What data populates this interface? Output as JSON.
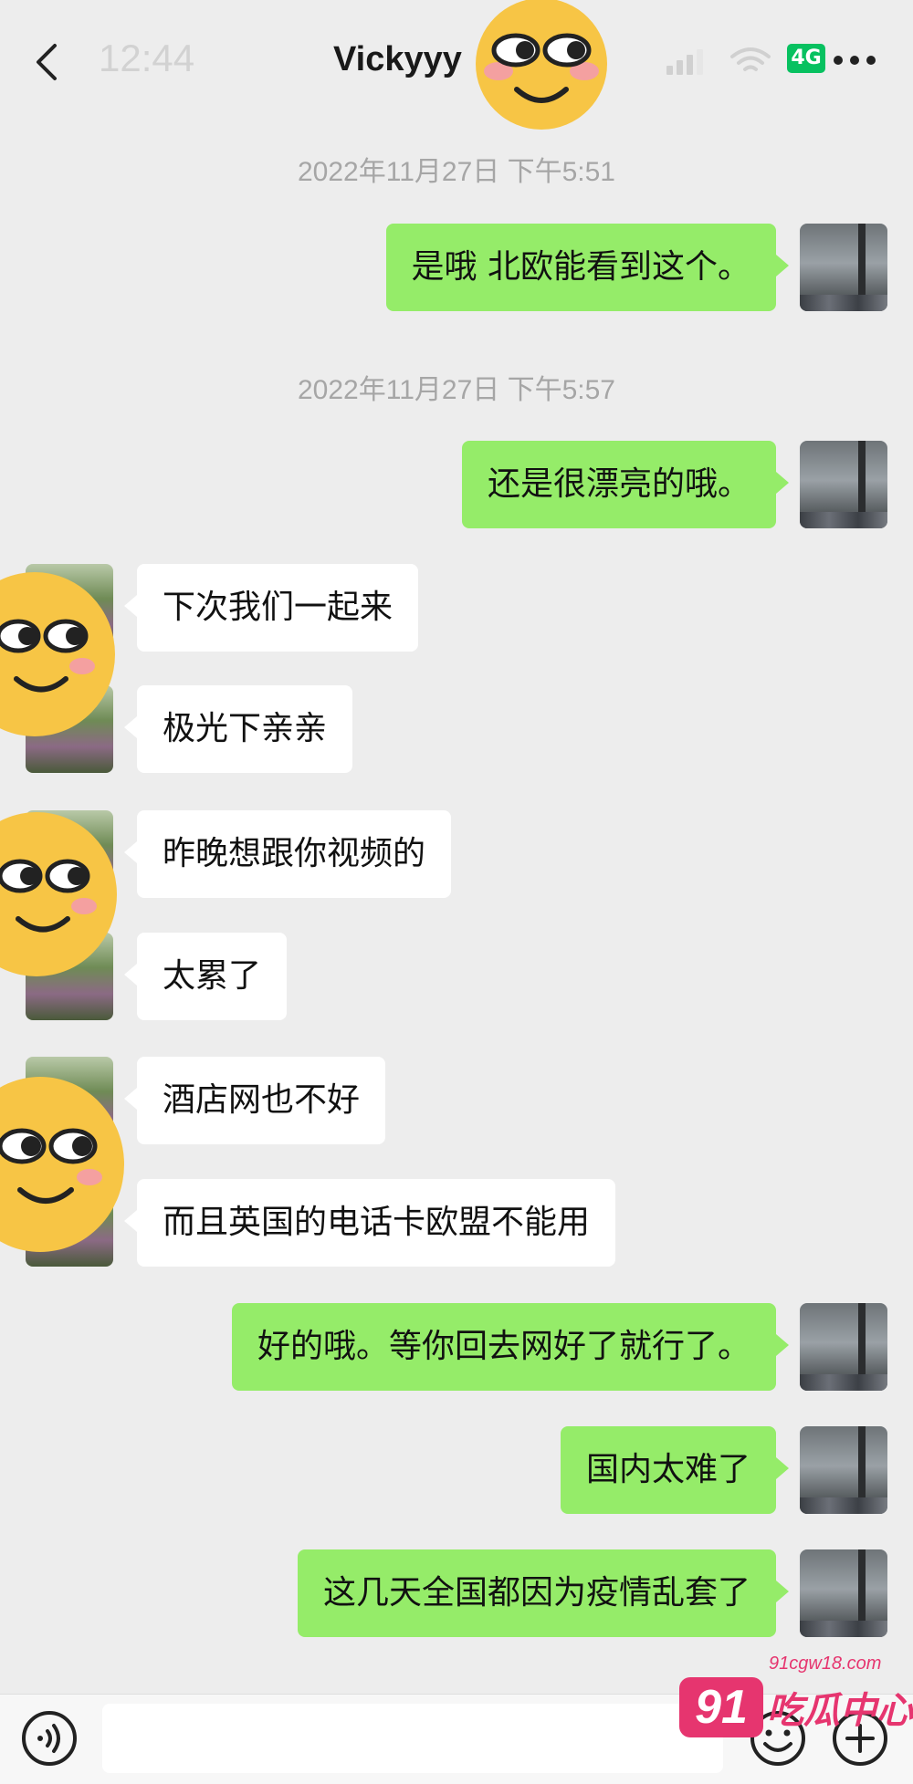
{
  "status_bar": {
    "time": "12:44",
    "network": "4G"
  },
  "header": {
    "title": "Vickyyy"
  },
  "timestamps": [
    "2022年11月27日 下午5:51",
    "2022年11月27日 下午5:57"
  ],
  "messages": [
    {
      "side": "sent",
      "text": "是哦 北欧能看到这个。"
    },
    {
      "side": "sent",
      "text": "还是很漂亮的哦。"
    },
    {
      "side": "received",
      "text": "下次我们一起来"
    },
    {
      "side": "received",
      "text": "极光下亲亲"
    },
    {
      "side": "received",
      "text": "昨晚想跟你视频的"
    },
    {
      "side": "received",
      "text": "太累了"
    },
    {
      "side": "received",
      "text": "酒店网也不好"
    },
    {
      "side": "received",
      "text": "而且英国的电话卡欧盟不能用"
    },
    {
      "side": "sent",
      "text": "好的哦。等你回去网好了就行了。"
    },
    {
      "side": "sent",
      "text": "国内太难了"
    },
    {
      "side": "sent",
      "text": "这几天全国都因为疫情乱套了"
    }
  ],
  "watermark": {
    "url": "91cgw18.com",
    "number": "91",
    "text": "吃瓜中心"
  },
  "colors": {
    "sent_bubble": "#95ec69",
    "received_bubble": "#ffffff",
    "background": "#ededed",
    "badge": "#07c160",
    "watermark": "#e6356f"
  },
  "icons": [
    "back-icon",
    "signal-icon",
    "wifi-icon",
    "more-icon",
    "voice-icon",
    "emoji-icon",
    "plus-icon"
  ]
}
